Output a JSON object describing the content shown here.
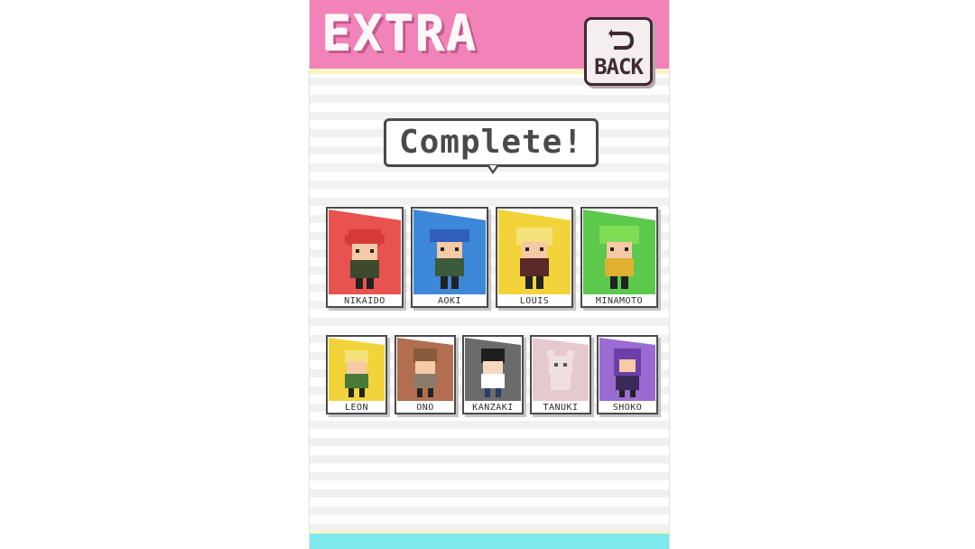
{
  "header": {
    "title": "EXTRA",
    "back_label": "BACK",
    "color": "#f183b8"
  },
  "banner": {
    "text": "Complete!"
  },
  "characters_row1": [
    {
      "name": "NIKAIDO",
      "color": "#e8534f",
      "hair": "#d63a37",
      "icon": "redhead-character-icon"
    },
    {
      "name": "AOKI",
      "color": "#3d87d9",
      "hair": "#2f5fb8",
      "icon": "blue-cap-character-icon"
    },
    {
      "name": "LOUIS",
      "color": "#f2d33a",
      "hair": "#f5e27a",
      "icon": "blonde-character-icon"
    },
    {
      "name": "MINAMOTO",
      "color": "#5cc94c",
      "hair": "#7fdc55",
      "icon": "green-hair-character-icon"
    }
  ],
  "characters_row2": [
    {
      "name": "LEON",
      "color": "#f2d33a",
      "hair": "#f5e27a",
      "icon": "blonde-boy-character-icon"
    },
    {
      "name": "ONO",
      "color": "#b36e52",
      "hair": "#8a5a3d",
      "icon": "brown-hair-character-icon"
    },
    {
      "name": "KANZAKI",
      "color": "#6b6b6b",
      "hair": "#1e1e1e",
      "icon": "black-hair-character-icon"
    },
    {
      "name": "TANUKI",
      "color": "#e6c9cc",
      "hair": "#f1dfe0",
      "icon": "tanuki-character-icon"
    },
    {
      "name": "SHOKO",
      "color": "#9a6bd1",
      "hair": "#6c3fa8",
      "icon": "purple-hair-character-icon"
    }
  ]
}
